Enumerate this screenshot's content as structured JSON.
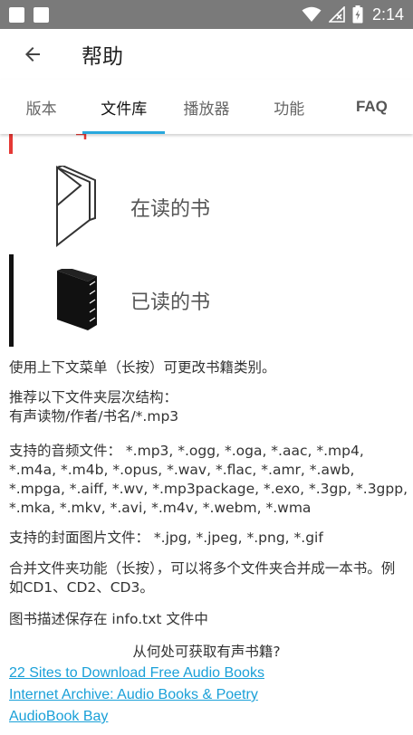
{
  "status_bar": {
    "time": "2:14"
  },
  "app_bar": {
    "title": "帮助"
  },
  "tabs": [
    {
      "label": "版本"
    },
    {
      "label": "文件库"
    },
    {
      "label": "播放器"
    },
    {
      "label": "功能"
    },
    {
      "label": "FAQ"
    }
  ],
  "active_tab": "文件库",
  "library": {
    "reading_label": "在读的书",
    "read_label": "已读的书",
    "paragraphs": {
      "context_menu": "使用上下文菜单（长按）可更改书籍类别。",
      "folder_structure_line1": "推荐以下文件夹层次结构：",
      "folder_structure_line2": "有声读物/作者/书名/*.mp3",
      "audio_formats": "支持的音频文件： *.mp3, *.ogg, *.oga, *.aac, *.mp4, *.m4a, *.m4b, *.opus, *.wav, *.flac, *.amr, *.awb, *.mpga, *.aiff, *.wv, *.mp3package, *.exo, *.3gp, *.3gpp, *.mka, *.mkv, *.avi, *.m4v, *.webm, *.wma",
      "cover_formats": "支持的封面图片文件： *.jpg, *.jpeg, *.png, *.gif",
      "merge_folders": "合并文件夹功能（长按），可以将多个文件夹合并成一本书。例如CD1、CD2、CD3。",
      "description_file": "图书描述保存在 info.txt 文件中"
    },
    "where_heading": "从何处可获取有声书籍?",
    "links": [
      {
        "text": "22 Sites to Download Free Audio Books"
      },
      {
        "text": "Internet Archive: Audio Books & Poetry"
      },
      {
        "text": "AudioBook Bay"
      }
    ]
  },
  "colors": {
    "status_bar": "#7a7a7a",
    "accent": "#29a8dd",
    "link": "#1aa0d8",
    "reading_marker": "#e53935"
  }
}
